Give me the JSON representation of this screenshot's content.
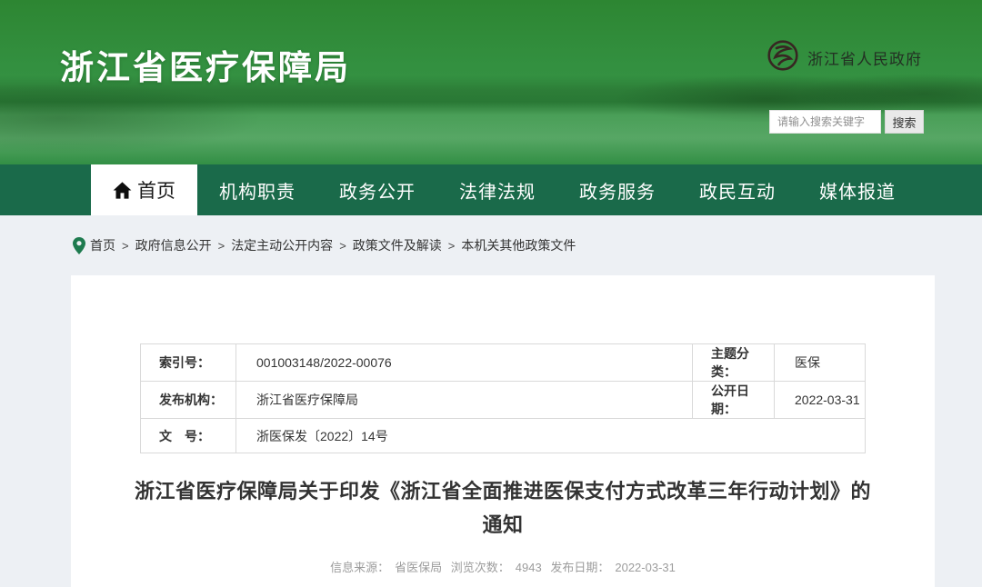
{
  "banner": {
    "site_title": "浙江省医疗保障局",
    "gov_name": "浙江省人民政府",
    "search": {
      "placeholder": "请输入搜索关键字",
      "button_label": "搜索"
    }
  },
  "nav": {
    "active": {
      "label": "首页"
    },
    "items": [
      {
        "label": "机构职责"
      },
      {
        "label": "政务公开"
      },
      {
        "label": "法律法规"
      },
      {
        "label": "政务服务"
      },
      {
        "label": "政民互动"
      },
      {
        "label": "媒体报道"
      }
    ]
  },
  "breadcrumb": {
    "separator": ">",
    "items": [
      "首页",
      "政府信息公开",
      "法定主动公开内容",
      "政策文件及解读",
      "本机关其他政策文件"
    ]
  },
  "document": {
    "meta_table": {
      "index_label": "索引号：",
      "index_value": "001003148/2022-00076",
      "topic_label": "主题分类：",
      "topic_value": "医保",
      "agency_label": "发布机构：",
      "agency_value": "浙江省医疗保障局",
      "open_date_label": "公开日期：",
      "open_date_value": "2022-03-31",
      "docnum_label": "文　号：",
      "docnum_value": "浙医保发〔2022〕14号"
    },
    "title": "浙江省医疗保障局关于印发《浙江省全面推进医保支付方式改革三年行动计划》的通知",
    "source_line": {
      "source_label": "信息来源：",
      "source_value": "省医保局",
      "views_label": "浏览次数：",
      "views_value": "4943",
      "date_label": "发布日期：",
      "date_value": "2022-03-31"
    }
  },
  "colors": {
    "banner_green": "#2d8632",
    "nav_green": "#1a6a4a",
    "accent_green": "#1e7b4f",
    "page_bg": "#edf0f4"
  }
}
